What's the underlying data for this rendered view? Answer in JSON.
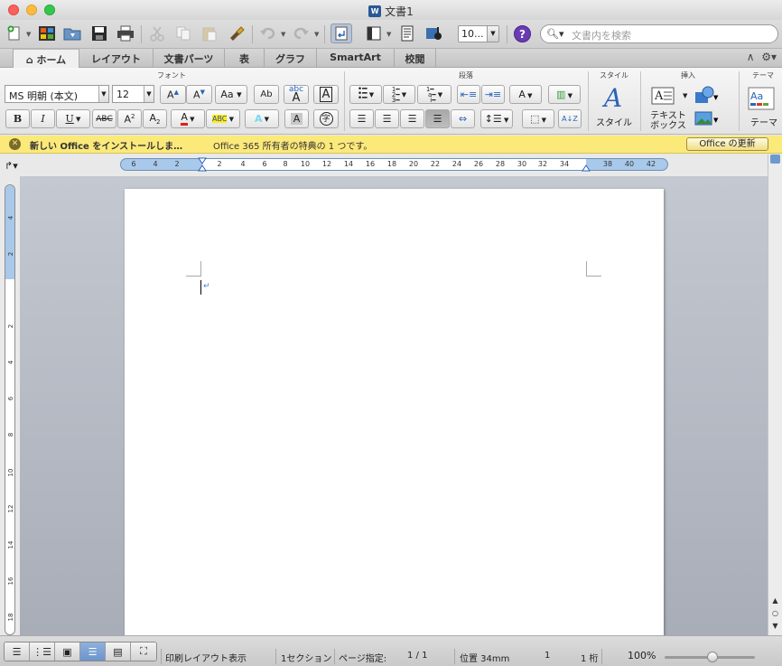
{
  "window": {
    "title": "文書1"
  },
  "toolbar": {
    "zoom_value": "10...",
    "search_placeholder": "文書内を検索"
  },
  "tabs": [
    "ホーム",
    "レイアウト",
    "文書パーツ",
    "表",
    "グラフ",
    "SmartArt",
    "校閲"
  ],
  "ribbon": {
    "groups": {
      "font": "フォント",
      "paragraph": "段落",
      "style": "スタイル",
      "insert": "挿入",
      "theme": "テーマ"
    },
    "font_name": "MS 明朝 (本文)",
    "font_size": "12",
    "style_label": "スタイル",
    "textbox_label_1": "テキスト",
    "textbox_label_2": "ボックス",
    "theme_label": "テーマ"
  },
  "infobar": {
    "message": "新しい Office をインストールしま…",
    "detail": "Office 365 所有者の特典の 1 つです。",
    "button": "Office の更新"
  },
  "ruler": {
    "h_ticks": [
      "6",
      "4",
      "2",
      "2",
      "4",
      "6",
      "8",
      "10",
      "12",
      "14",
      "16",
      "18",
      "20",
      "22",
      "24",
      "26",
      "28",
      "30",
      "32",
      "34",
      "38",
      "40",
      "42"
    ],
    "v_ticks": [
      "4",
      "2",
      "2",
      "4",
      "6",
      "8",
      "10",
      "12",
      "14",
      "16",
      "18"
    ]
  },
  "status": {
    "view_name": "印刷レイアウト表示",
    "section": "1セクション",
    "page_label": "ページ指定:",
    "page_value": "1 / 1",
    "position": "位置 34mm",
    "line": "1",
    "column": "1 桁",
    "zoom": "100%"
  },
  "colors": {
    "ruler_blue": "#a9c9eb",
    "infobar": "#fbe97a",
    "help_purple": "#6a3bb3",
    "font_color_red": "#e0201a",
    "highlight_yellow": "#ffee00"
  }
}
